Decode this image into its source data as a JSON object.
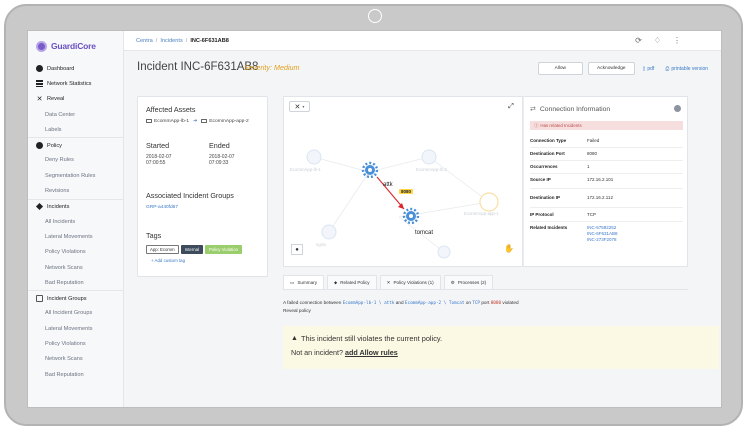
{
  "app": {
    "logo_text": "GuardiCore"
  },
  "breadcrumb": {
    "root": "Centra",
    "section": "Incidents",
    "current": "INC-6F631AB8"
  },
  "sidebar": {
    "groups": [
      {
        "label": "Dashboard",
        "icon": "dashboard-icon",
        "children": []
      },
      {
        "label": "Network Statistics",
        "icon": "network-statistics-icon",
        "children": []
      },
      {
        "label": "Reveal",
        "icon": "reveal-icon",
        "children": [
          "Data Center",
          "Labels"
        ]
      },
      {
        "label": "Policy",
        "icon": "policy-icon",
        "children": [
          "Deny Rules",
          "Segmentation Rules",
          "Revisions"
        ]
      },
      {
        "label": "Incidents",
        "icon": "incidents-icon",
        "children": [
          "All Incidents",
          "Lateral Movements",
          "Policy Violations",
          "Network Scans",
          "Bad Reputation"
        ]
      },
      {
        "label": "Incident Groups",
        "icon": "incident-groups-icon",
        "children": [
          "All Incident Groups",
          "Lateral Movements",
          "Policy Violations",
          "Network Scans",
          "Bad Reputation"
        ]
      }
    ]
  },
  "header": {
    "title": "Incident INC-6F631AB8",
    "severity": "Severity: Medium",
    "allow_label": "Allow",
    "acknowledge_label": "Acknowledge",
    "pdf_label": "pdf",
    "printable_label": "printable version"
  },
  "affected": {
    "title": "Affected Assets",
    "source_asset": "EcommApp-lb-1",
    "dest_asset": "EcommApp-app-2",
    "started_label": "Started",
    "started_date": "2018-02-07",
    "started_time": "07:00:55",
    "ended_label": "Ended",
    "ended_date": "2018-02-07",
    "ended_time": "07:09:33",
    "groups_title": "Associated Incident Groups",
    "group_id": "GRP-a440fd67",
    "tags_title": "Tags",
    "tags": [
      "App: Ecomm",
      "Internal",
      "Policy Violation"
    ],
    "add_tag": "+ Add custom tag"
  },
  "graph": {
    "source_label": "attk",
    "dest_label": "tomcat",
    "port": "8080",
    "ghost_labels": [
      "EcommApp-lb-1",
      "EcommApp-lb-2",
      "EcommApp-app-1",
      "nginx"
    ]
  },
  "connection": {
    "title": "Connection Information",
    "alert": "Has related Incidents",
    "rows": [
      {
        "key": "Connection Type",
        "value": "Failed"
      },
      {
        "key": "Destination Port",
        "value": "8080"
      },
      {
        "key": "Occurrences",
        "value": "1"
      },
      {
        "key": "Source IP",
        "value": "172.16.2.101"
      },
      {
        "key": "Destination IP",
        "value": "172.16.2.112"
      },
      {
        "key": "IP Protocol",
        "value": "TCP"
      }
    ],
    "related_key": "Related Incidents",
    "related": [
      "INC-57592252",
      "INC-6F631AB8",
      "INC-273F2078"
    ]
  },
  "tabs": [
    {
      "label": "Summary",
      "icon": "summary-icon"
    },
    {
      "label": "Related Policy",
      "icon": "policy-icon"
    },
    {
      "label": "Policy Violations (1)",
      "icon": "violations-icon"
    },
    {
      "label": "Processes (2)",
      "icon": "processes-icon"
    }
  ],
  "summary": {
    "prefix": "A failed connection between",
    "src": "EcommApp-lb-1 \\ attk",
    "and": "and",
    "dst": "EcommApp-app-2 \\ Tomcat",
    "on": "on",
    "proto": "TCP",
    "port_word": "port",
    "port": "8080",
    "suffix": "violated",
    "line2": "Reveal policy"
  },
  "warning": {
    "line1": "This incident still violates the current policy.",
    "line2_prefix": "Not an incident?",
    "link": "add Allow rules"
  }
}
